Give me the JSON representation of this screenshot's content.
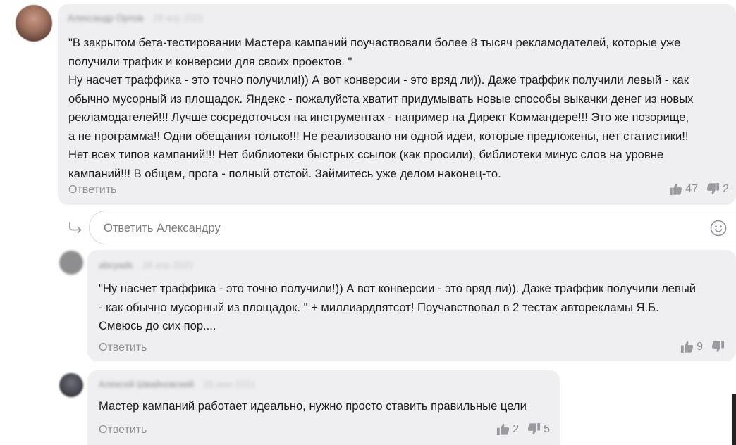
{
  "comments": [
    {
      "author": "Александр Орлов",
      "date": "28 апр 2021",
      "lines": [
        "\"В закрытом бета-тестировании Мастера кампаний поучаствовали более 8 тысяч рекламодателей, которые уже",
        "получили трафик и конверсии для своих проектов. \"",
        "Ну насчет траффика - это точно получили!)) А вот конверсии - это вряд ли)). Даже траффик получили левый - как",
        "обычно мусорный из площадок. Яндекс - пожалуйста хватит придумывать новые способы выкачки денег из новых",
        "рекламодателей!!! Лучше сосредоточься на инструментах - например на Директ Коммандере!!! Это же позорище,",
        "а не программа!! Одни обещания только!!! Не реализовано ни одной идеи, которые предложены, нет статистики!!",
        "Нет всех типов кампаний!!! Нет библиотеки быстрых ссылок (как просили), библиотеки минус слов на уровне",
        "кампаний!!! В общем, прога - полный отстой. Займитесь уже делом наконец-то."
      ],
      "reply_label": "Ответить",
      "likes": "47",
      "dislikes": "2"
    },
    {
      "author": "abcyads",
      "date": "28 апр 2021",
      "lines": [
        "\"Ну насчет траффика - это точно получили!)) А вот конверсии - это вряд ли)). Даже траффик получили левый",
        "- как обычно мусорный из площадок. \"  + миллиардпятсот! Поучавствовал в 2 тестах авторекламы Я.Б.",
        "Смеюсь до сих пор...."
      ],
      "reply_label": "Ответить",
      "likes": "9",
      "dislikes": ""
    },
    {
      "author": "Алексей Швайновский",
      "date": "29 мая 2021",
      "lines": [
        "Мастер кампаний работает идеально, нужно просто ставить правильные цели"
      ],
      "reply_label": "Ответить",
      "likes": "2",
      "dislikes": "5"
    }
  ],
  "reply_box": {
    "placeholder": "Ответить Александру",
    "icon": "emoji-smile-icon"
  },
  "colors": {
    "bubble": "#efeff1",
    "muted_text": "#8f8f94",
    "body_text": "#1c1c1e",
    "border": "#d9d9de"
  }
}
